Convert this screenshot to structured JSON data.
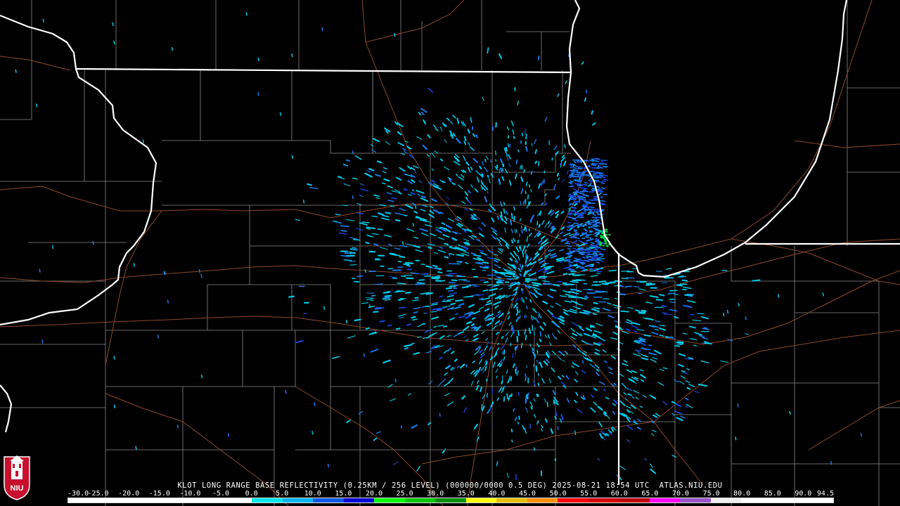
{
  "product": {
    "title": "KLOT LONG RANGE BASE REFLECTIVITY (0.25KM / 256 LEVEL) (000000/0000 0.5 DEG) 2025-08-21 18:54 UTC  ATLAS.NIU.EDU",
    "station": "KLOT",
    "timestamp": "2025-08-21 18:54 UTC",
    "elevation": "0.5 DEG",
    "source": "ATLAS.NIU.EDU"
  },
  "color_scale": {
    "labels": [
      "-30.0",
      "-25.0",
      "-20.0",
      "-15.0",
      "-10.0",
      "-5.0",
      "0.0",
      "5.0",
      "10.0",
      "15.0",
      "20.0",
      "25.0",
      "30.0",
      "35.0",
      "40.0",
      "45.0",
      "50.0",
      "55.0",
      "60.0",
      "65.0",
      "70.0",
      "75.0",
      "80.0",
      "85.0",
      "90.0",
      "94.5"
    ],
    "colors": [
      "#ffffff",
      "#ffffff",
      "#ffffff",
      "#ffffff",
      "#ffffff",
      "#ffffff",
      "#00e8ec",
      "#00b4f0",
      "#0a5ae6",
      "#0000d8",
      "#00ff00",
      "#00c800",
      "#009000",
      "#ffff00",
      "#e7c000",
      "#ff9000",
      "#ff0000",
      "#d60000",
      "#c00000",
      "#ff00ff",
      "#9955c9",
      "#eeeeee",
      "#ffffff",
      "#ffffff",
      "#ffffff"
    ]
  },
  "logo": {
    "text": "NIU",
    "color": "#c8102e"
  },
  "map": {
    "state_line_color": "#ffffff",
    "county_line_color": "#8a8a8a",
    "road_color": "#8b4a2b",
    "echo_colors": {
      "light": "#00c8e6",
      "medium": "#1a7ae8",
      "strong": "#1544d8",
      "peak": "#00d84a"
    }
  }
}
